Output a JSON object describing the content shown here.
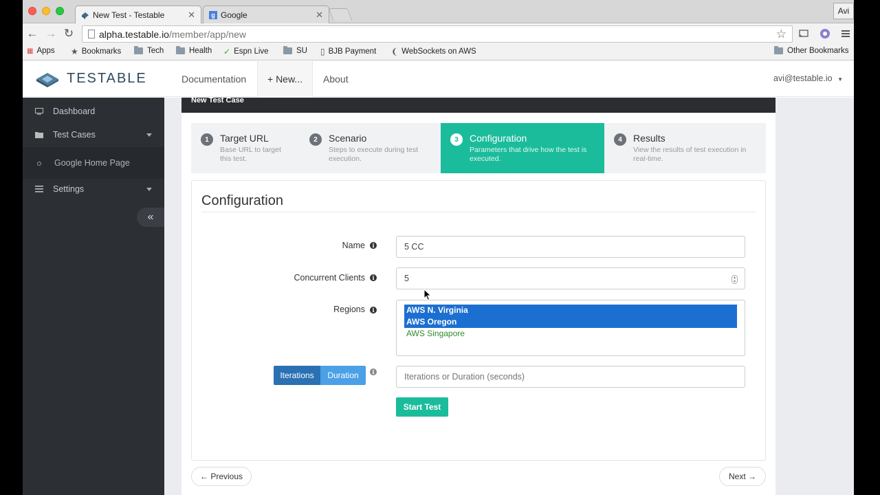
{
  "browser": {
    "tabs": [
      {
        "title": "New Test - Testable",
        "active": true
      },
      {
        "title": "Google",
        "active": false
      }
    ],
    "profile": "Avi",
    "url_host": "alpha.testable.io",
    "url_path": "/member/app/new",
    "bookmarks": [
      {
        "label": "Apps",
        "icon": "apps-grid-icon"
      },
      {
        "label": "Bookmarks",
        "icon": "star-icon"
      },
      {
        "label": "Tech",
        "icon": "folder-icon"
      },
      {
        "label": "Health",
        "icon": "folder-icon"
      },
      {
        "label": "Espn Live",
        "icon": "bookmark-icon"
      },
      {
        "label": "SU",
        "icon": "folder-icon"
      },
      {
        "label": "BJB Payment",
        "icon": "page-icon"
      },
      {
        "label": "WebSockets on AWS",
        "icon": "bookmark-icon"
      },
      {
        "label": "Other Bookmarks",
        "icon": "folder-icon"
      }
    ]
  },
  "app": {
    "brand": "TESTABLE",
    "nav": {
      "documentation": "Documentation",
      "new": "+ New...",
      "about": "About"
    },
    "user": "avi@testable.io"
  },
  "sidebar": {
    "dashboard": "Dashboard",
    "test_cases": "Test Cases",
    "test_case_item": "Google Home Page",
    "settings": "Settings",
    "collapse": "«"
  },
  "panel": {
    "header": "New Test Case"
  },
  "steps": [
    {
      "num": "1",
      "title": "Target URL",
      "desc": "Base URL to target this test."
    },
    {
      "num": "2",
      "title": "Scenario",
      "desc": "Steps to execute during test execution."
    },
    {
      "num": "3",
      "title": "Configuration",
      "desc": "Parameters that drive how the test is executed."
    },
    {
      "num": "4",
      "title": "Results",
      "desc": "View the results of test execution in real-time."
    }
  ],
  "active_step": 3,
  "form": {
    "title": "Configuration",
    "name_label": "Name",
    "name_value": "5 CC",
    "clients_label": "Concurrent Clients",
    "clients_value": "5",
    "regions_label": "Regions",
    "regions": [
      {
        "label": "AWS N. Virginia",
        "selected": true
      },
      {
        "label": "AWS Oregon",
        "selected": true
      },
      {
        "label": "AWS Singapore",
        "selected": false
      }
    ],
    "iterations_label": "Iterations",
    "duration_label": "Duration",
    "iter_placeholder": "Iterations or Duration (seconds)",
    "start_button": "Start Test"
  },
  "pager": {
    "previous": "← Previous",
    "next": "Next →"
  },
  "colors": {
    "accent": "#1bbc9b",
    "sidebar": "#2c2f34",
    "selection": "#1b6fd1"
  }
}
